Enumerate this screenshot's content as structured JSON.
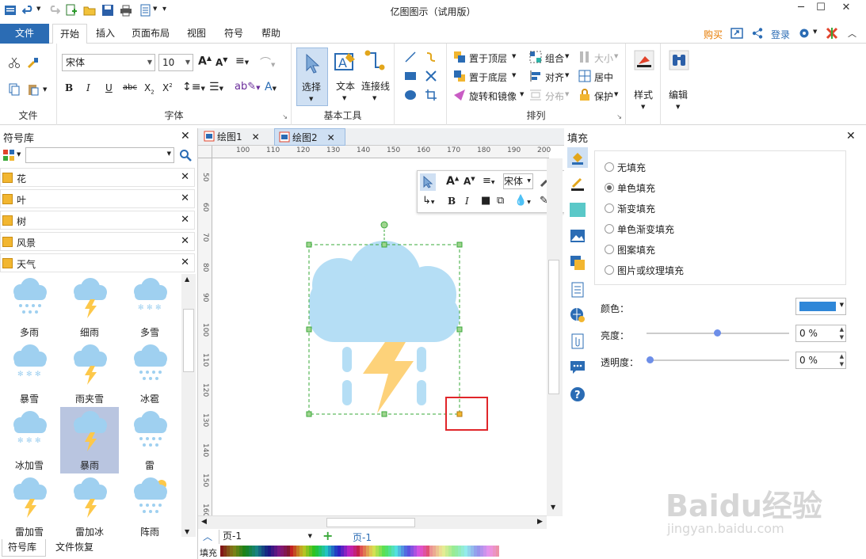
{
  "window": {
    "title": "亿图图示（试用版）",
    "min": "─",
    "max": "☐",
    "close": "✕"
  },
  "menu": {
    "file": "文件",
    "tabs": [
      "开始",
      "插入",
      "页面布局",
      "视图",
      "符号",
      "帮助"
    ],
    "right": {
      "buy": "购买",
      "login": "登录"
    }
  },
  "ribbon": {
    "file_group": "文件",
    "font": {
      "family": "宋体",
      "size": "10",
      "label": "字体"
    },
    "tools": {
      "select": "选择",
      "text": "文本",
      "connector": "连接线",
      "label": "基本工具"
    },
    "arrange": {
      "bring_front": "置于顶层",
      "send_back": "置于底层",
      "rotate_mirror": "旋转和镜像",
      "group": "组合",
      "align": "对齐",
      "distribute": "分布",
      "size": "大小",
      "center": "居中",
      "protect": "保护",
      "label": "排列"
    },
    "style": "样式",
    "edit": "编辑"
  },
  "library": {
    "title": "符号库",
    "search_placeholder": "",
    "categories": [
      "花",
      "叶",
      "树",
      "风景",
      "天气"
    ],
    "symbols": [
      "多雨",
      "细雨",
      "多雪",
      "暴雪",
      "雨夹雪",
      "冰雹",
      "冰加雪",
      "暴雨",
      "雷",
      "雷加雪",
      "雷加冰",
      "阵雨"
    ],
    "selected_symbol": "暴雨",
    "bottom_tabs": [
      "符号库",
      "文件恢复"
    ]
  },
  "doc_tabs": [
    "绘图1",
    "绘图2"
  ],
  "active_doc_tab": "绘图2",
  "ruler_top": [
    "100",
    "110",
    "120",
    "130",
    "140",
    "150",
    "160",
    "170",
    "180",
    "190",
    "200"
  ],
  "ruler_left": [
    "50",
    "60",
    "70",
    "80",
    "90",
    "100",
    "110",
    "120",
    "130",
    "140",
    "150",
    "160"
  ],
  "floating_toolbar": {
    "font": "宋体"
  },
  "page_bar": {
    "page_select": "页-1",
    "page_tab": "页-1"
  },
  "palette_label": "填充",
  "fill_panel": {
    "title": "填充",
    "options": [
      "无填充",
      "单色填充",
      "渐变填充",
      "单色渐变填充",
      "图案填充",
      "图片或纹理填充"
    ],
    "selected": "单色填充",
    "color_label": "颜色：",
    "color_value": "#2f87d8",
    "brightness_label": "亮度：",
    "brightness_value": "0 %",
    "transparency_label": "透明度：",
    "transparency_value": "0 %"
  },
  "watermark": {
    "brand": "Baidu经验",
    "url": "jingyan.baidu.com"
  },
  "colors": {
    "accent": "#2b6cb4",
    "cloud": "#b5def5",
    "bolt": "#fdd27a",
    "selection": "#3aa83a",
    "highlight": "#e0262a"
  }
}
